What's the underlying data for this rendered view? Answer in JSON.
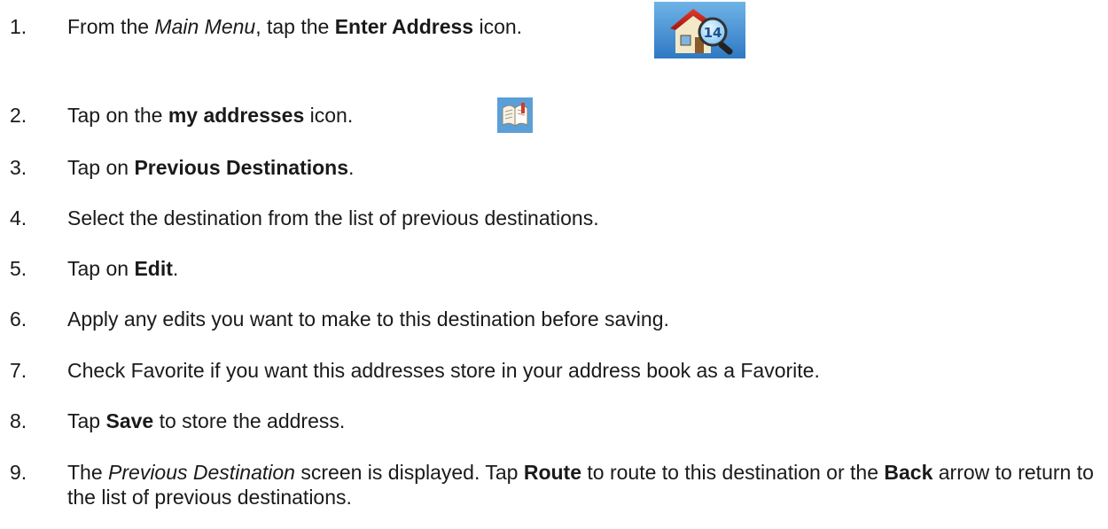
{
  "steps": [
    {
      "num": "1.",
      "a": "From the ",
      "b_ital": "Main Menu",
      "c": ", tap the ",
      "d_bold": "Enter Address",
      "e": " icon."
    },
    {
      "num": "2.",
      "a": "Tap on the ",
      "b_bold": "my addresses",
      "c": " icon."
    },
    {
      "num": "3.",
      "a": "Tap on ",
      "b_bold": "Previous Destinations",
      "c": "."
    },
    {
      "num": "4.",
      "a": "Select the destination from the list of previous destinations."
    },
    {
      "num": "5.",
      "a": "Tap on ",
      "b_bold": "Edit",
      "c": "."
    },
    {
      "num": "6.",
      "a": "Apply any edits you want to make to this destination before saving."
    },
    {
      "num": "7.",
      "a": "Check Favorite if you want this addresses store in your address book as a Favorite."
    },
    {
      "num": "8.",
      "a": "Tap ",
      "b_bold": "Save",
      "c": " to store the address."
    },
    {
      "num": "9.",
      "a": "The ",
      "b_ital": "Previous Destination",
      "c": " screen is displayed.  Tap ",
      "d_bold": "Route",
      "e": " to route to this destination or the ",
      "f_bold": "Back",
      "g": " arrow to return to the list of previous destinations."
    }
  ],
  "icons": {
    "enter_address": {
      "name": "enter-address-icon",
      "badge": "14"
    },
    "my_addresses": {
      "name": "address-book-icon"
    }
  }
}
